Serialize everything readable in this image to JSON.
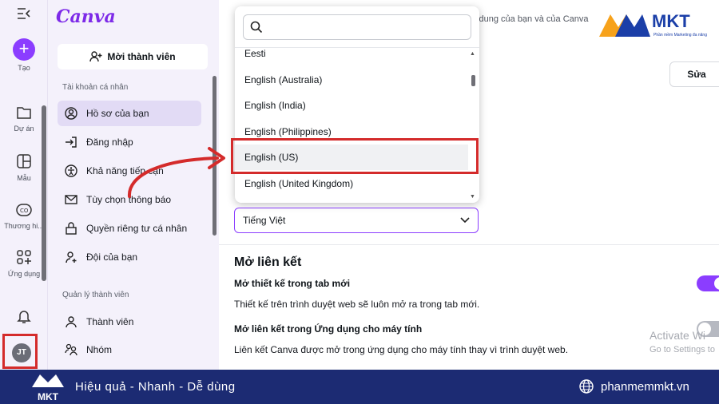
{
  "rail": {
    "create_label": "Tạo",
    "items": [
      {
        "label": "Dự án",
        "icon": "folder-icon"
      },
      {
        "label": "Mẫu",
        "icon": "template-icon"
      },
      {
        "label": "Thương hi...",
        "icon": "brand-icon"
      },
      {
        "label": "Ứng dụng",
        "icon": "apps-icon"
      }
    ],
    "avatar_initials": "JT"
  },
  "sidebar": {
    "logo": "Canva",
    "invite_label": "Mời thành viên",
    "personal_section": "Tài khoản cá nhân",
    "personal_items": [
      {
        "label": "Hồ sơ của bạn",
        "icon": "profile-icon"
      },
      {
        "label": "Đăng nhập",
        "icon": "login-icon"
      },
      {
        "label": "Khả năng tiếp cận",
        "icon": "accessibility-icon"
      },
      {
        "label": "Tùy chọn thông báo",
        "icon": "mail-icon"
      },
      {
        "label": "Quyền riêng tư cá nhân",
        "icon": "lock-icon"
      },
      {
        "label": "Đội của bạn",
        "icon": "team-icon"
      }
    ],
    "member_section": "Quản lý thành viên",
    "member_items": [
      {
        "label": "Thành viên",
        "icon": "person-icon"
      },
      {
        "label": "Nhóm",
        "icon": "group-icon"
      }
    ]
  },
  "main": {
    "search_text": "i dung của bạn và của Canva",
    "edit_label": "Sửa",
    "language_value": "Tiếng Việt",
    "links_heading": "Mở liên kết",
    "setting1_title": "Mở thiết kế trong tab mới",
    "setting1_desc": "Thiết kế trên trình duyệt web sẽ luôn mở ra trong tab mới.",
    "setting2_title": "Mở liên kết trong Ứng dụng cho máy tính",
    "setting2_desc": "Liên kết Canva được mở trong ứng dụng cho máy tính thay vì trình duyệt web.",
    "watermark_line1": "Activate Wi",
    "watermark_line2": "Go to Settings to"
  },
  "dropdown": {
    "options": [
      "Eesti",
      "English (Australia)",
      "English (India)",
      "English (Philippines)",
      "English (US)",
      "English (United Kingdom)"
    ],
    "selected": "English (US)"
  },
  "brand": {
    "top_logo": "MKT",
    "top_sub": "Phần mềm Marketing đa năng",
    "tagline": "Hiệu quả - Nhanh - Dễ dùng",
    "site": "phanmemmkt.vn",
    "banner_logo": "MKT"
  },
  "colors": {
    "accent": "#8b3dff",
    "highlight": "#d42b2b",
    "banner": "#1c2b73"
  }
}
